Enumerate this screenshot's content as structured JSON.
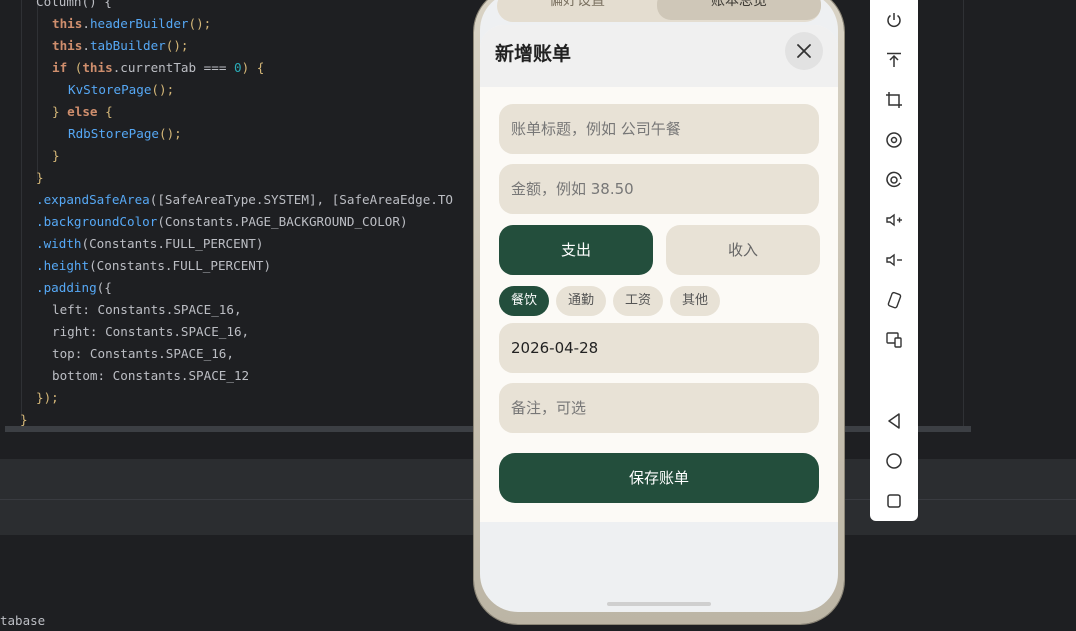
{
  "code": {
    "lines": [
      {
        "t": "plain",
        "a": "Column() {"
      },
      {
        "t": "call",
        "obj": "this",
        "fn": "headerBuilder",
        "end": "();"
      },
      {
        "t": "call",
        "obj": "this",
        "fn": "tabBuilder",
        "end": "();"
      },
      {
        "t": "if",
        "a": "if",
        "b": "this",
        "c": ".currentTab === ",
        "d": "0",
        "e": ") {"
      },
      {
        "t": "fn",
        "fn": "KvStorePage",
        "end": "();"
      },
      {
        "t": "else",
        "a": "} ",
        "b": "else",
        "c": " {"
      },
      {
        "t": "fn",
        "fn": "RdbStorePage",
        "end": "();"
      },
      {
        "t": "plain",
        "a": "}"
      },
      {
        "t": "plain",
        "a": "}"
      },
      {
        "t": "method",
        "fn": ".expandSafeArea",
        "rest": "([SafeAreaType.SYSTEM], [SafeAreaEdge.TO"
      },
      {
        "t": "method",
        "fn": ".backgroundColor",
        "rest": "(Constants.PAGE_BACKGROUND_COLOR)"
      },
      {
        "t": "method",
        "fn": ".width",
        "rest": "(Constants.FULL_PERCENT)"
      },
      {
        "t": "method",
        "fn": ".height",
        "rest": "(Constants.FULL_PERCENT)"
      },
      {
        "t": "method",
        "fn": ".padding",
        "rest": "({"
      },
      {
        "t": "plain",
        "a": "left: Constants.SPACE_16,"
      },
      {
        "t": "plain",
        "a": "right: Constants.SPACE_16,"
      },
      {
        "t": "plain",
        "a": "top: Constants.SPACE_16,"
      },
      {
        "t": "plain",
        "a": "bottom: Constants.SPACE_12"
      },
      {
        "t": "plain",
        "a": "});"
      },
      {
        "t": "plain",
        "a": "}"
      }
    ],
    "status_text": "tabase"
  },
  "phone": {
    "tabs": {
      "left": "偏好设置",
      "right": "账本总览"
    },
    "sheet_title": "新增账单",
    "title_placeholder": "账单标题，例如 公司午餐",
    "amount_placeholder": "金额，例如 38.50",
    "type_toggle": {
      "expense": "支出",
      "income": "收入",
      "selected": "支出"
    },
    "categories": [
      "餐饮",
      "通勤",
      "工资",
      "其他"
    ],
    "selected_category": "餐饮",
    "date_value": "2026-04-28",
    "note_placeholder": "备注，可选",
    "save_label": "保存账单"
  },
  "toolbar": {
    "icons": [
      "power-icon",
      "pin-top-icon",
      "crop-icon",
      "rotate-icon",
      "screenshot-icon",
      "volume-up-icon",
      "volume-down-icon",
      "shake-icon",
      "multi-screen-icon",
      "back-icon",
      "home-icon",
      "recent-apps-icon"
    ]
  },
  "colors": {
    "accent": "#234e3c",
    "field_bg": "#e8e2d6",
    "editor_bg": "#1e1f22"
  }
}
